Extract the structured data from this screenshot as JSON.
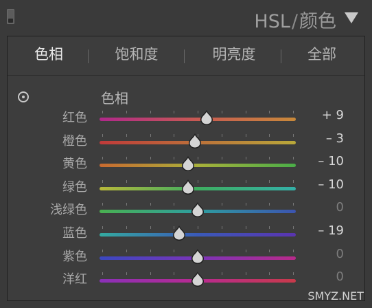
{
  "header": {
    "title_hsl": "HSL",
    "title_sep": "/",
    "title_color": "颜色"
  },
  "tabs": [
    {
      "label": "色相",
      "active": true
    },
    {
      "label": "饱和度",
      "active": false
    },
    {
      "label": "明亮度",
      "active": false
    },
    {
      "label": "全部",
      "active": false
    }
  ],
  "section": {
    "label": "色相"
  },
  "sliders": [
    {
      "label": "红色",
      "value_text": "+ 9",
      "value": 9,
      "gradient": [
        "#b0288a",
        "#c85a52",
        "#c8893a"
      ]
    },
    {
      "label": "橙色",
      "value_text": "– 3",
      "value": -3,
      "gradient": [
        "#c03a3a",
        "#b9a83a"
      ]
    },
    {
      "label": "黄色",
      "value_text": "– 10",
      "value": -10,
      "gradient": [
        "#c86a30",
        "#a8b03a",
        "#4aae48"
      ]
    },
    {
      "label": "绿色",
      "value_text": "– 10",
      "value": -10,
      "gradient": [
        "#b8b83a",
        "#3eae60",
        "#34b0a8"
      ]
    },
    {
      "label": "浅绿色",
      "value_text": "0",
      "value": 0,
      "gradient": [
        "#4ab050",
        "#2e9ea0",
        "#3c54b0"
      ]
    },
    {
      "label": "蓝色",
      "value_text": "– 19",
      "value": -19,
      "gradient": [
        "#34aaa0",
        "#3a5ab8",
        "#5a34b0"
      ]
    },
    {
      "label": "紫色",
      "value_text": "0",
      "value": 0,
      "gradient": [
        "#3a48c0",
        "#7a34b8",
        "#b82a8a"
      ]
    },
    {
      "label": "洋红",
      "value_text": "0",
      "value": 0,
      "gradient": [
        "#8a30b8",
        "#b82a90",
        "#c83a4a"
      ]
    }
  ],
  "slider_range": [
    -100,
    100
  ],
  "watermark": "SMYZ.NET"
}
